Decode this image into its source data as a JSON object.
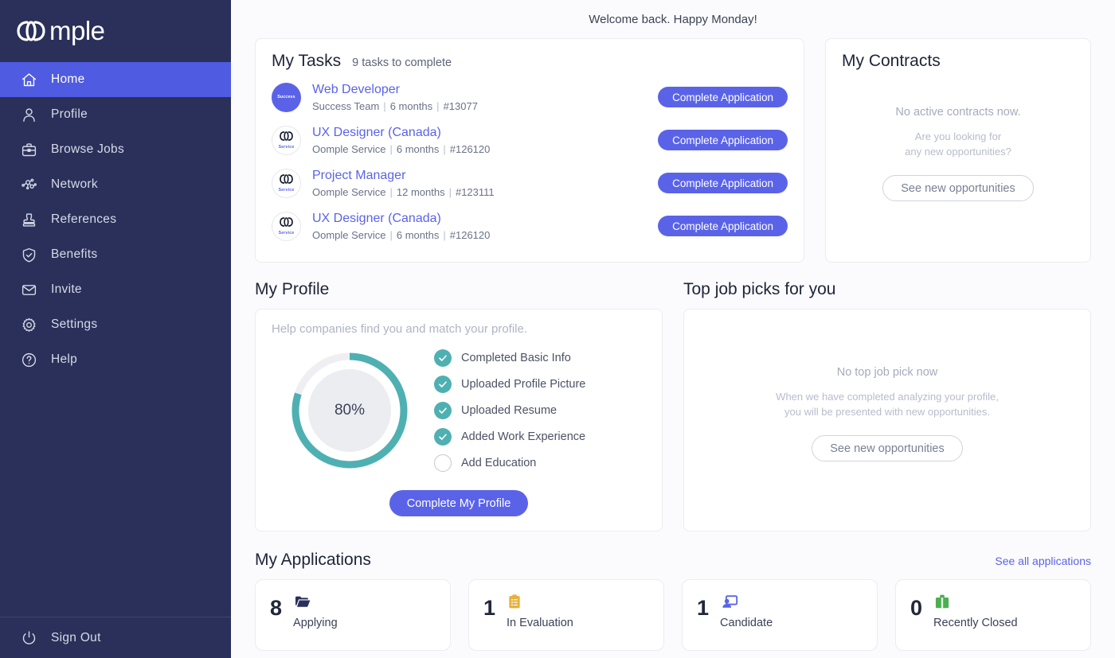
{
  "brand": {
    "logo_text": "mple",
    "full_name": "Oomple"
  },
  "colors": {
    "sidebar_bg": "#2A3059",
    "sidebar_active": "#4F5BE0",
    "primary": "#5A63E8",
    "teal": "#4FB0B2",
    "page_bg": "#FBFBFD",
    "applying": "#2A3059",
    "in_evaluation": "#E8B13C",
    "candidate": "#5A63E8",
    "recently_closed": "#4CAF50"
  },
  "sidebar": {
    "items": [
      {
        "label": "Home",
        "icon": "home-icon",
        "active": true
      },
      {
        "label": "Profile",
        "icon": "person-icon",
        "active": false
      },
      {
        "label": "Browse Jobs",
        "icon": "briefcase-icon",
        "active": false
      },
      {
        "label": "Network",
        "icon": "network-icon",
        "active": false
      },
      {
        "label": "References",
        "icon": "stamp-icon",
        "active": false
      },
      {
        "label": "Benefits",
        "icon": "shield-icon",
        "active": false
      },
      {
        "label": "Invite",
        "icon": "envelope-icon",
        "active": false
      },
      {
        "label": "Settings",
        "icon": "gear-icon",
        "active": false
      },
      {
        "label": "Help",
        "icon": "question-icon",
        "active": false
      }
    ],
    "sign_out": {
      "label": "Sign Out",
      "icon": "power-icon"
    }
  },
  "topbar": {
    "greeting": "Welcome back. Happy Monday!"
  },
  "tasks": {
    "title": "My Tasks",
    "subtitle": "9 tasks to complete",
    "items": [
      {
        "title": "Web Developer",
        "company": "Success Team",
        "duration": "6 months",
        "ref": "#13077",
        "avatar_type": "success",
        "avatar_label": "Success",
        "button": "Complete Application"
      },
      {
        "title": "UX Designer (Canada)",
        "company": "Oomple Service",
        "duration": "6 months",
        "ref": "#126120",
        "avatar_type": "service",
        "avatar_label": "Service",
        "button": "Complete Application"
      },
      {
        "title": "Project Manager",
        "company": "Oomple Service",
        "duration": "12 months",
        "ref": "#123111",
        "avatar_type": "service",
        "avatar_label": "Service",
        "button": "Complete Application"
      },
      {
        "title": "UX Designer (Canada)",
        "company": "Oomple Service",
        "duration": "6 months",
        "ref": "#126120",
        "avatar_type": "service",
        "avatar_label": "Service",
        "button": "Complete Application"
      }
    ]
  },
  "contracts": {
    "title": "My Contracts",
    "empty_main": "No active contracts now.",
    "empty_sub_line1": "Are you looking for",
    "empty_sub_line2": "any new opportunities?",
    "button": "See new opportunities"
  },
  "profile": {
    "section_title": "My Profile",
    "hint": "Help companies find you and match your profile.",
    "percent_label": "80%",
    "percent_value": 80,
    "checklist": [
      {
        "label": "Completed Basic Info",
        "done": true
      },
      {
        "label": "Uploaded Profile Picture",
        "done": true
      },
      {
        "label": "Uploaded Resume",
        "done": true
      },
      {
        "label": "Added Work Experience",
        "done": true
      },
      {
        "label": "Add Education",
        "done": false
      }
    ],
    "button": "Complete My Profile"
  },
  "job_picks": {
    "section_title": "Top job picks for you",
    "empty_main": "No top job pick now",
    "empty_sub_line1": "When we have completed analyzing your profile,",
    "empty_sub_line2": "you will be presented with new opportunities.",
    "button": "See new opportunities"
  },
  "applications": {
    "title": "My Applications",
    "see_all": "See all applications",
    "cards": [
      {
        "count": "8",
        "label": "Applying",
        "icon": "folder-icon",
        "color": "#2A3059"
      },
      {
        "count": "1",
        "label": "In Evaluation",
        "icon": "clipboard-icon",
        "color": "#E8B13C"
      },
      {
        "count": "1",
        "label": "Candidate",
        "icon": "interview-icon",
        "color": "#5A63E8"
      },
      {
        "count": "0",
        "label": "Recently Closed",
        "icon": "briefcase-icon",
        "color": "#4CAF50"
      }
    ]
  }
}
